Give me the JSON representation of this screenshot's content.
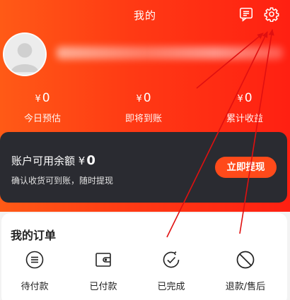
{
  "header": {
    "title": "我的",
    "message_icon": "message-icon",
    "settings_icon": "gear-icon"
  },
  "profile": {
    "avatar_icon": "default-avatar-icon"
  },
  "stats": [
    {
      "currency": "¥",
      "amount": "0",
      "label": "今日预估"
    },
    {
      "currency": "¥",
      "amount": "0",
      "label": "即将到账"
    },
    {
      "currency": "¥",
      "amount": "0",
      "label": "累计收益"
    }
  ],
  "balance": {
    "label": "账户可用余额",
    "currency": "¥",
    "amount": "0",
    "subtitle": "确认收货可到账，随时提现",
    "withdraw_label": "立即提现"
  },
  "orders": {
    "title": "我的订单",
    "items": [
      {
        "label": "待付款",
        "icon": "pending-payment-icon"
      },
      {
        "label": "已付款",
        "icon": "wallet-icon"
      },
      {
        "label": "已完成",
        "icon": "completed-check-icon"
      },
      {
        "label": "退款/售后",
        "icon": "prohibited-icon"
      }
    ]
  },
  "colors": {
    "header_gradient_start": "#ff5a16",
    "header_gradient_end": "#ff2012",
    "balance_card_bg": "#2a2b31",
    "withdraw_button": "#ff4a1a",
    "annotation_arrow": "#e01010"
  }
}
